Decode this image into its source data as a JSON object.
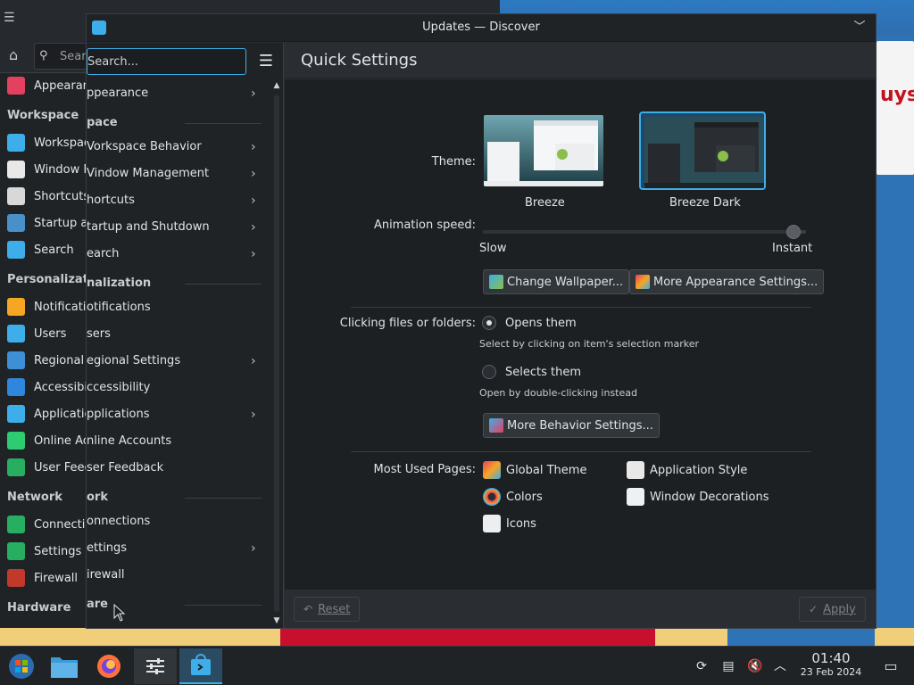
{
  "desktop": {
    "cartoon_text": "uys"
  },
  "settings_window": {
    "search_placeholder": "Sear",
    "sidebar": [
      {
        "type": "item",
        "label": "Appearan",
        "icon": "appearance-icon",
        "color": "#e4405f"
      },
      {
        "type": "header",
        "label": "Workspace"
      },
      {
        "type": "item",
        "label": "Workspac",
        "icon": "workspace-icon",
        "color": "#3daee9"
      },
      {
        "type": "item",
        "label": "Window M",
        "icon": "window-icon",
        "color": "#e8e8e8"
      },
      {
        "type": "item",
        "label": "Shortcuts",
        "icon": "keyboard-icon",
        "color": "#d8d8d8"
      },
      {
        "type": "item",
        "label": "Startup a",
        "icon": "startup-icon",
        "color": "#4a90c8"
      },
      {
        "type": "item",
        "label": "Search",
        "icon": "search-icon",
        "color": "#3daee9"
      },
      {
        "type": "header",
        "label": "Personalizatio"
      },
      {
        "type": "item",
        "label": "Notificatio",
        "icon": "bell-icon",
        "color": "#f5a623"
      },
      {
        "type": "item",
        "label": "Users",
        "icon": "users-icon",
        "color": "#3daee9"
      },
      {
        "type": "item",
        "label": "Regional",
        "icon": "regional-icon",
        "color": "#3d8fd6"
      },
      {
        "type": "item",
        "label": "Accessibili",
        "icon": "accessibility-icon",
        "color": "#2e86de"
      },
      {
        "type": "item",
        "label": "Applicatio",
        "icon": "applications-icon",
        "color": "#3daee9"
      },
      {
        "type": "item",
        "label": "Online Ac",
        "icon": "online-accounts-icon",
        "color": "#2ecc71"
      },
      {
        "type": "item",
        "label": "User Feed",
        "icon": "user-feedback-icon",
        "color": "#27ae60"
      },
      {
        "type": "header",
        "label": "Network"
      },
      {
        "type": "item",
        "label": "Connectio",
        "icon": "globe-icon",
        "color": "#27ae60"
      },
      {
        "type": "item",
        "label": "Settings",
        "icon": "globe-icon",
        "color": "#27ae60"
      },
      {
        "type": "item",
        "label": "Firewall",
        "icon": "firewall-icon",
        "color": "#c0392b"
      },
      {
        "type": "header",
        "label": "Hardware"
      }
    ]
  },
  "discover_window": {
    "title": "Updates — Discover",
    "search_placeholder": "Search...",
    "menu": [
      {
        "type": "item",
        "label": "ppearance",
        "chevron": true
      },
      {
        "type": "header",
        "label": "pace"
      },
      {
        "type": "item",
        "label": "Vorkspace Behavior",
        "chevron": true
      },
      {
        "type": "item",
        "label": "Vindow Management",
        "chevron": true
      },
      {
        "type": "item",
        "label": "hortcuts",
        "chevron": true
      },
      {
        "type": "item",
        "label": "tartup and Shutdown",
        "chevron": true
      },
      {
        "type": "item",
        "label": "earch",
        "chevron": true
      },
      {
        "type": "header",
        "label": "nalization"
      },
      {
        "type": "item",
        "label": "otifications",
        "chevron": false
      },
      {
        "type": "item",
        "label": "sers",
        "chevron": false
      },
      {
        "type": "item",
        "label": "egional Settings",
        "chevron": true
      },
      {
        "type": "item",
        "label": "ccessibility",
        "chevron": false
      },
      {
        "type": "item",
        "label": "pplications",
        "chevron": true
      },
      {
        "type": "item",
        "label": "nline Accounts",
        "chevron": false
      },
      {
        "type": "item",
        "label": "ser Feedback",
        "chevron": false
      },
      {
        "type": "header",
        "label": "ork"
      },
      {
        "type": "item",
        "label": "onnections",
        "chevron": false
      },
      {
        "type": "item",
        "label": "ettings",
        "chevron": true
      },
      {
        "type": "item",
        "label": "irewall",
        "chevron": false
      },
      {
        "type": "header",
        "label": "are"
      }
    ],
    "quick_settings": {
      "heading": "Quick Settings",
      "theme_label": "Theme:",
      "themes": [
        {
          "name": "Breeze",
          "selected": false
        },
        {
          "name": "Breeze Dark",
          "selected": true
        }
      ],
      "animation_label": "Animation speed:",
      "animation_min": "Slow",
      "animation_max": "Instant",
      "animation_value": 1.0,
      "change_wallpaper": "Change Wallpaper...",
      "more_appearance": "More Appearance Settings...",
      "clicking_label": "Clicking files or folders:",
      "opens_them": "Opens them",
      "opens_hint": "Select by clicking on item's selection marker",
      "selects_them": "Selects them",
      "selects_hint": "Open by double-clicking instead",
      "click_selected": "opens",
      "more_behavior": "More Behavior Settings...",
      "most_used_label": "Most Used Pages:",
      "most_used": [
        {
          "label": "Global Theme",
          "icon": "global-theme-icon"
        },
        {
          "label": "Application Style",
          "icon": "application-style-icon"
        },
        {
          "label": "Colors",
          "icon": "colors-icon"
        },
        {
          "label": "Window Decorations",
          "icon": "window-decorations-icon"
        },
        {
          "label": "Icons",
          "icon": "icons-icon"
        }
      ],
      "reset": "Reset",
      "apply": "Apply"
    }
  },
  "taskbar": {
    "apps": [
      {
        "name": "application-launcher",
        "icon": "start-orb-icon"
      },
      {
        "name": "file-manager",
        "icon": "folder-icon"
      },
      {
        "name": "firefox",
        "icon": "firefox-icon"
      },
      {
        "name": "system-settings",
        "icon": "settings-sliders-icon"
      },
      {
        "name": "discover",
        "icon": "discover-icon"
      }
    ],
    "time": "01:40",
    "date": "23 Feb 2024"
  },
  "colors": {
    "accent": "#3daee9",
    "window_bg": "#2a2e32",
    "view_bg": "#1d2023",
    "sidebar_bg": "#202326"
  }
}
